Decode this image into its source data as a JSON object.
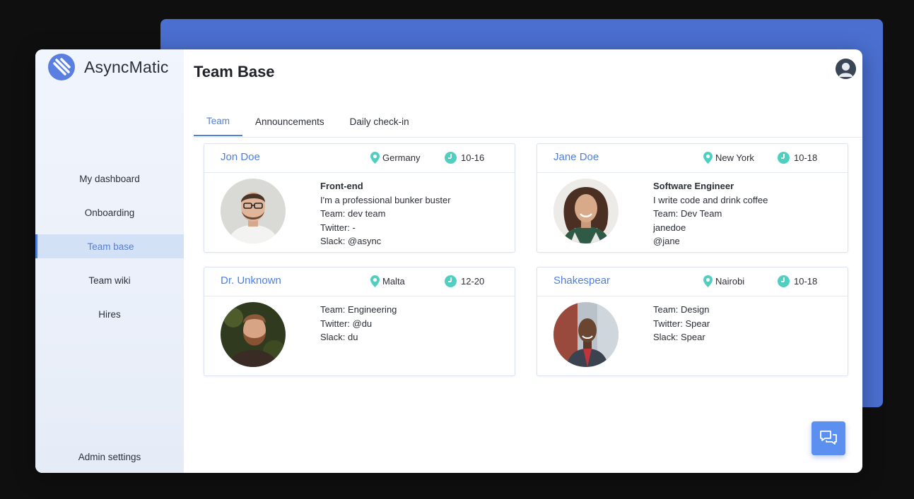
{
  "app": {
    "name": "AsyncMatic"
  },
  "sidebar": {
    "items": [
      {
        "label": "My dashboard"
      },
      {
        "label": "Onboarding"
      },
      {
        "label": "Team base"
      },
      {
        "label": "Team wiki"
      },
      {
        "label": "Hires"
      }
    ],
    "bottom": {
      "label": "Admin settings"
    }
  },
  "page": {
    "title": "Team Base"
  },
  "tabs": [
    {
      "label": "Team"
    },
    {
      "label": "Announcements"
    },
    {
      "label": "Daily check-in"
    }
  ],
  "cards": [
    {
      "name": "Jon Doe",
      "location": "Germany",
      "hours": "10-16",
      "lines": [
        "Front-end",
        "I'm a professional bunker buster",
        "Team: dev team",
        "Twitter: -",
        "Slack: @async"
      ]
    },
    {
      "name": "Jane Doe",
      "location": "New York",
      "hours": "10-18",
      "lines": [
        "Software Engineer",
        "I write code and drink coffee",
        "Team: Dev Team",
        "janedoe",
        "@jane"
      ]
    },
    {
      "name": "Dr. Unknown",
      "location": "Malta",
      "hours": "12-20",
      "lines": [
        "Team: Engineering",
        "Twitter: @du",
        "Slack: du"
      ]
    },
    {
      "name": "Shakespear",
      "location": "Nairobi",
      "hours": "10-18",
      "lines": [
        "Team: Design",
        "Twitter: Spear",
        "Slack: Spear"
      ]
    }
  ],
  "icons": {
    "logo": "asyncmatic-logo-icon",
    "location": "location-pin-icon",
    "hours": "clock-icon",
    "chat": "chat-icon",
    "avatar": "user-avatar-icon"
  },
  "colors": {
    "accent": "#4f7fe0",
    "backdrop_panel": "#4a6fd0",
    "teal": "#4fcfc0",
    "chat_button": "#5b8ff0"
  }
}
